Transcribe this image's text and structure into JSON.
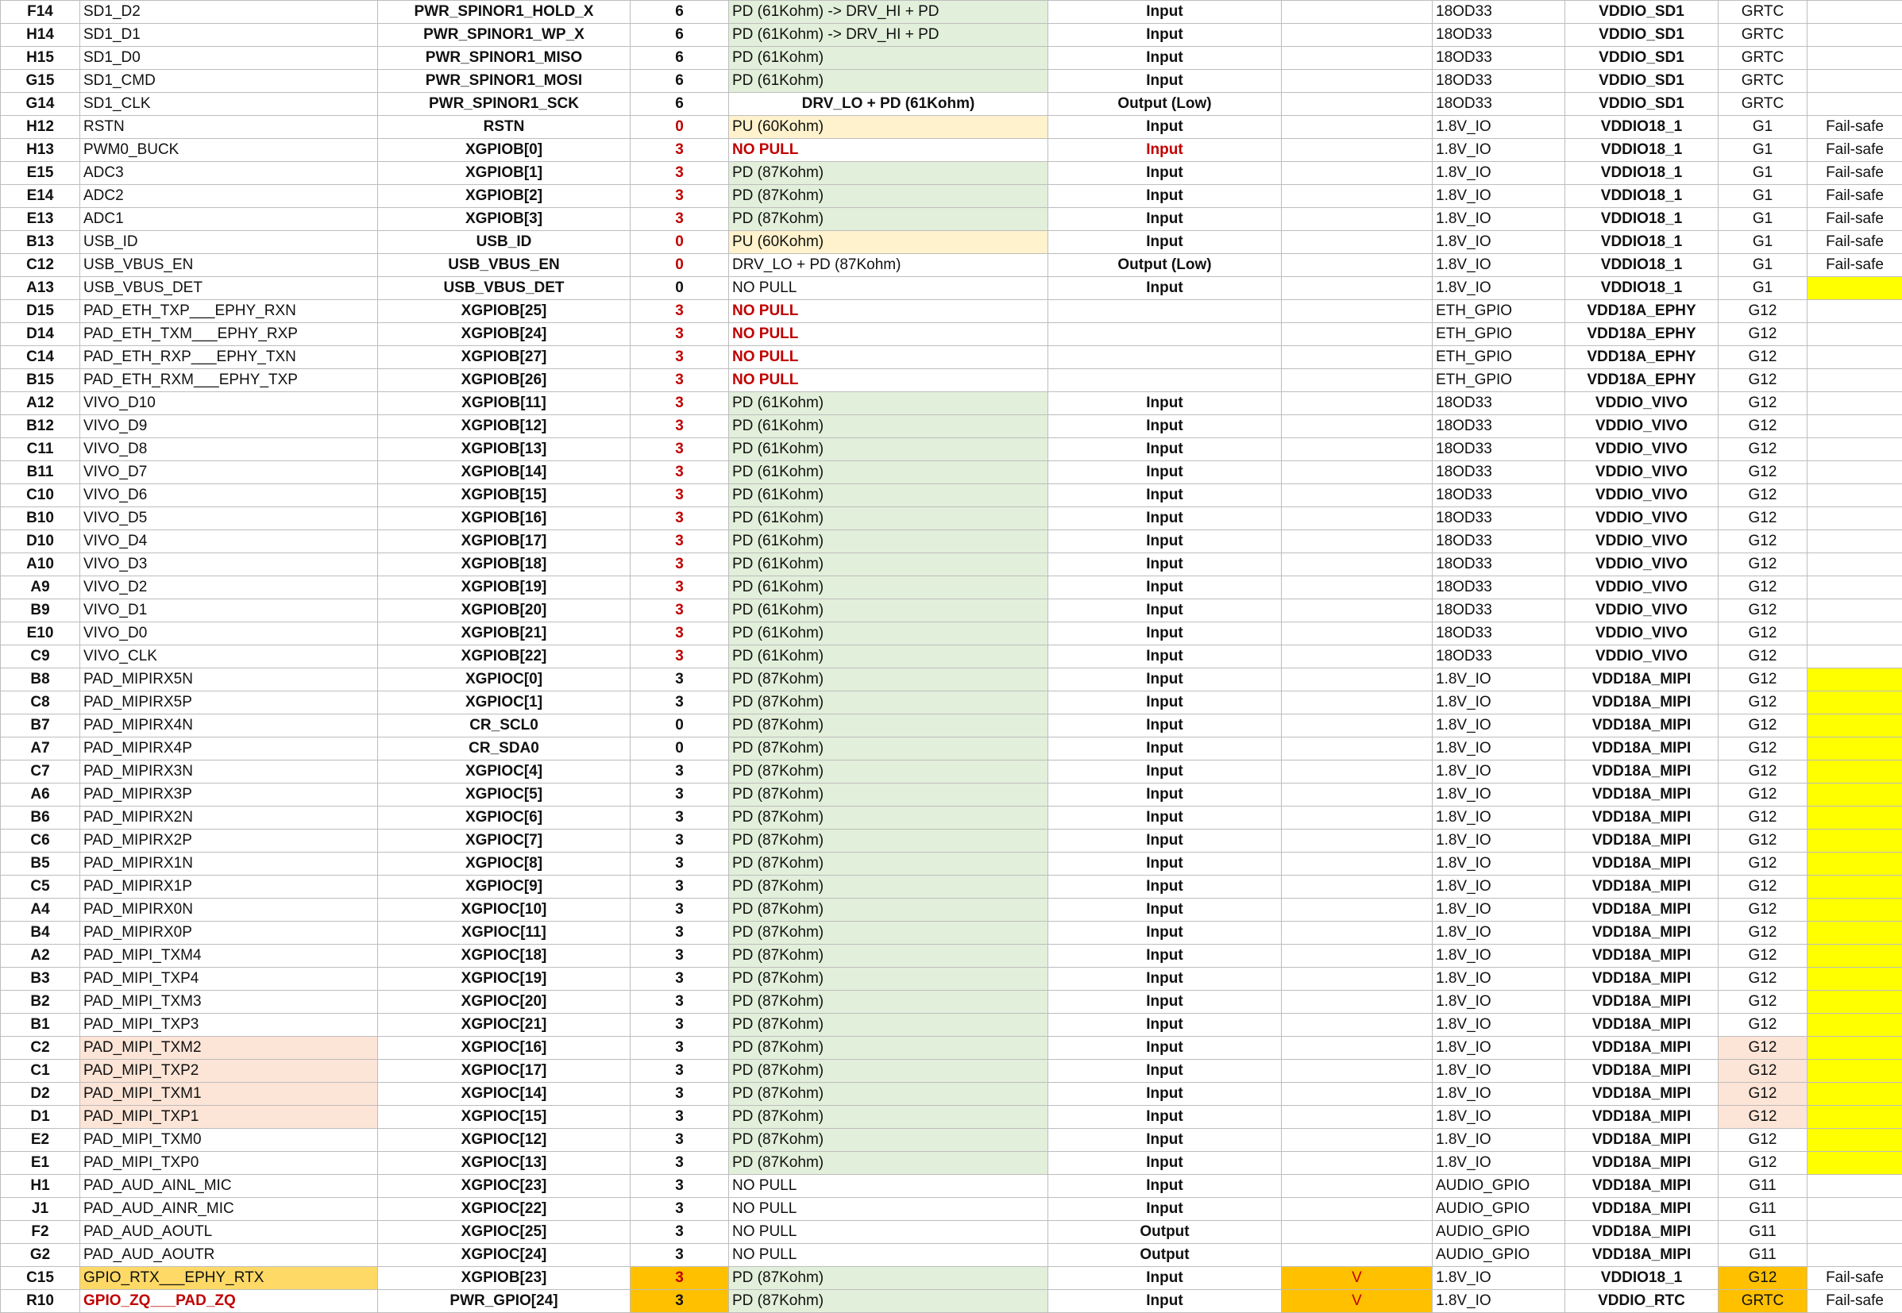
{
  "sheet": {
    "rows": [
      {
        "ball": "F14",
        "name": "SD1_D2",
        "func": "PWR_SPINOR1_HOLD_X",
        "mux": "6",
        "pull": "PD (61Kohm) -> DRV_HI + PD",
        "dir": "Input",
        "v": "",
        "iotype": "18OD33",
        "power": "VDDIO_SD1",
        "group": "GRTC",
        "note": ""
      },
      {
        "ball": "H14",
        "name": "SD1_D1",
        "func": "PWR_SPINOR1_WP_X",
        "mux": "6",
        "pull": "PD (61Kohm) -> DRV_HI + PD",
        "dir": "Input",
        "v": "",
        "iotype": "18OD33",
        "power": "VDDIO_SD1",
        "group": "GRTC",
        "note": ""
      },
      {
        "ball": "H15",
        "name": "SD1_D0",
        "func": "PWR_SPINOR1_MISO",
        "mux": "6",
        "pull": "PD (61Kohm)",
        "dir": "Input",
        "v": "",
        "iotype": "18OD33",
        "power": "VDDIO_SD1",
        "group": "GRTC",
        "note": ""
      },
      {
        "ball": "G15",
        "name": "SD1_CMD",
        "func": "PWR_SPINOR1_MOSI",
        "mux": "6",
        "pull": "PD (61Kohm)",
        "dir": "Input",
        "v": "",
        "iotype": "18OD33",
        "power": "VDDIO_SD1",
        "group": "GRTC",
        "note": ""
      },
      {
        "ball": "G14",
        "name": "SD1_CLK",
        "func": "PWR_SPINOR1_SCK",
        "mux": "6",
        "pull": "DRV_LO + PD (61Kohm)",
        "dir": "Output (Low)",
        "v": "",
        "iotype": "18OD33",
        "power": "VDDIO_SD1",
        "group": "GRTC",
        "note": ""
      },
      {
        "ball": "H12",
        "name": "RSTN",
        "func": "RSTN",
        "mux": "0",
        "pull": "PU (60Kohm)",
        "dir": "Input",
        "v": "",
        "iotype": "1.8V_IO",
        "power": "VDDIO18_1",
        "group": "G1",
        "note": "Fail-safe"
      },
      {
        "ball": "H13",
        "name": "PWM0_BUCK",
        "func": "XGPIOB[0]",
        "mux": "3",
        "pull": "NO PULL",
        "dir": "Input",
        "v": "",
        "iotype": "1.8V_IO",
        "power": "VDDIO18_1",
        "group": "G1",
        "note": "Fail-safe"
      },
      {
        "ball": "E15",
        "name": "ADC3",
        "func": "XGPIOB[1]",
        "mux": "3",
        "pull": "PD (87Kohm)",
        "dir": "Input",
        "v": "",
        "iotype": "1.8V_IO",
        "power": "VDDIO18_1",
        "group": "G1",
        "note": "Fail-safe"
      },
      {
        "ball": "E14",
        "name": "ADC2",
        "func": "XGPIOB[2]",
        "mux": "3",
        "pull": "PD (87Kohm)",
        "dir": "Input",
        "v": "",
        "iotype": "1.8V_IO",
        "power": "VDDIO18_1",
        "group": "G1",
        "note": "Fail-safe"
      },
      {
        "ball": "E13",
        "name": "ADC1",
        "func": "XGPIOB[3]",
        "mux": "3",
        "pull": "PD (87Kohm)",
        "dir": "Input",
        "v": "",
        "iotype": "1.8V_IO",
        "power": "VDDIO18_1",
        "group": "G1",
        "note": "Fail-safe"
      },
      {
        "ball": "B13",
        "name": "USB_ID",
        "func": "USB_ID",
        "mux": "0",
        "pull": "PU (60Kohm)",
        "dir": "Input",
        "v": "",
        "iotype": "1.8V_IO",
        "power": "VDDIO18_1",
        "group": "G1",
        "note": "Fail-safe"
      },
      {
        "ball": "C12",
        "name": "USB_VBUS_EN",
        "func": "USB_VBUS_EN",
        "mux": "0",
        "pull": "DRV_LO + PD (87Kohm)",
        "dir": "Output (Low)",
        "v": "",
        "iotype": "1.8V_IO",
        "power": "VDDIO18_1",
        "group": "G1",
        "note": "Fail-safe"
      },
      {
        "ball": "A13",
        "name": "USB_VBUS_DET",
        "func": "USB_VBUS_DET",
        "mux": "0",
        "pull": "NO PULL",
        "dir": "Input",
        "v": "",
        "iotype": "1.8V_IO",
        "power": "VDDIO18_1",
        "group": "G1",
        "note": ""
      },
      {
        "ball": "D15",
        "name": "PAD_ETH_TXP___EPHY_RXN",
        "func": "XGPIOB[25]",
        "mux": "3",
        "pull": "NO PULL",
        "dir": "",
        "v": "",
        "iotype": "ETH_GPIO",
        "power": "VDD18A_EPHY",
        "group": "G12",
        "note": ""
      },
      {
        "ball": "D14",
        "name": "PAD_ETH_TXM___EPHY_RXP",
        "func": "XGPIOB[24]",
        "mux": "3",
        "pull": "NO PULL",
        "dir": "",
        "v": "",
        "iotype": "ETH_GPIO",
        "power": "VDD18A_EPHY",
        "group": "G12",
        "note": ""
      },
      {
        "ball": "C14",
        "name": "PAD_ETH_RXP___EPHY_TXN",
        "func": "XGPIOB[27]",
        "mux": "3",
        "pull": "NO PULL",
        "dir": "",
        "v": "",
        "iotype": "ETH_GPIO",
        "power": "VDD18A_EPHY",
        "group": "G12",
        "note": ""
      },
      {
        "ball": "B15",
        "name": "PAD_ETH_RXM___EPHY_TXP",
        "func": "XGPIOB[26]",
        "mux": "3",
        "pull": "NO PULL",
        "dir": "",
        "v": "",
        "iotype": "ETH_GPIO",
        "power": "VDD18A_EPHY",
        "group": "G12",
        "note": ""
      },
      {
        "ball": "A12",
        "name": "VIVO_D10",
        "func": "XGPIOB[11]",
        "mux": "3",
        "pull": "PD (61Kohm)",
        "dir": "Input",
        "v": "",
        "iotype": "18OD33",
        "power": "VDDIO_VIVO",
        "group": "G12",
        "note": ""
      },
      {
        "ball": "B12",
        "name": "VIVO_D9",
        "func": "XGPIOB[12]",
        "mux": "3",
        "pull": "PD (61Kohm)",
        "dir": "Input",
        "v": "",
        "iotype": "18OD33",
        "power": "VDDIO_VIVO",
        "group": "G12",
        "note": ""
      },
      {
        "ball": "C11",
        "name": "VIVO_D8",
        "func": "XGPIOB[13]",
        "mux": "3",
        "pull": "PD (61Kohm)",
        "dir": "Input",
        "v": "",
        "iotype": "18OD33",
        "power": "VDDIO_VIVO",
        "group": "G12",
        "note": ""
      },
      {
        "ball": "B11",
        "name": "VIVO_D7",
        "func": "XGPIOB[14]",
        "mux": "3",
        "pull": "PD (61Kohm)",
        "dir": "Input",
        "v": "",
        "iotype": "18OD33",
        "power": "VDDIO_VIVO",
        "group": "G12",
        "note": ""
      },
      {
        "ball": "C10",
        "name": "VIVO_D6",
        "func": "XGPIOB[15]",
        "mux": "3",
        "pull": "PD (61Kohm)",
        "dir": "Input",
        "v": "",
        "iotype": "18OD33",
        "power": "VDDIO_VIVO",
        "group": "G12",
        "note": ""
      },
      {
        "ball": "B10",
        "name": "VIVO_D5",
        "func": "XGPIOB[16]",
        "mux": "3",
        "pull": "PD (61Kohm)",
        "dir": "Input",
        "v": "",
        "iotype": "18OD33",
        "power": "VDDIO_VIVO",
        "group": "G12",
        "note": ""
      },
      {
        "ball": "D10",
        "name": "VIVO_D4",
        "func": "XGPIOB[17]",
        "mux": "3",
        "pull": "PD (61Kohm)",
        "dir": "Input",
        "v": "",
        "iotype": "18OD33",
        "power": "VDDIO_VIVO",
        "group": "G12",
        "note": ""
      },
      {
        "ball": "A10",
        "name": "VIVO_D3",
        "func": "XGPIOB[18]",
        "mux": "3",
        "pull": "PD (61Kohm)",
        "dir": "Input",
        "v": "",
        "iotype": "18OD33",
        "power": "VDDIO_VIVO",
        "group": "G12",
        "note": ""
      },
      {
        "ball": "A9",
        "name": "VIVO_D2",
        "func": "XGPIOB[19]",
        "mux": "3",
        "pull": "PD (61Kohm)",
        "dir": "Input",
        "v": "",
        "iotype": "18OD33",
        "power": "VDDIO_VIVO",
        "group": "G12",
        "note": ""
      },
      {
        "ball": "B9",
        "name": "VIVO_D1",
        "func": "XGPIOB[20]",
        "mux": "3",
        "pull": "PD (61Kohm)",
        "dir": "Input",
        "v": "",
        "iotype": "18OD33",
        "power": "VDDIO_VIVO",
        "group": "G12",
        "note": ""
      },
      {
        "ball": "E10",
        "name": "VIVO_D0",
        "func": "XGPIOB[21]",
        "mux": "3",
        "pull": "PD (61Kohm)",
        "dir": "Input",
        "v": "",
        "iotype": "18OD33",
        "power": "VDDIO_VIVO",
        "group": "G12",
        "note": ""
      },
      {
        "ball": "C9",
        "name": "VIVO_CLK",
        "func": "XGPIOB[22]",
        "mux": "3",
        "pull": "PD (61Kohm)",
        "dir": "Input",
        "v": "",
        "iotype": "18OD33",
        "power": "VDDIO_VIVO",
        "group": "G12",
        "note": ""
      },
      {
        "ball": "B8",
        "name": "PAD_MIPIRX5N",
        "func": "XGPIOC[0]",
        "mux": "3",
        "pull": "PD (87Kohm)",
        "dir": "Input",
        "v": "",
        "iotype": "1.8V_IO",
        "power": "VDD18A_MIPI",
        "group": "G12",
        "note": ""
      },
      {
        "ball": "C8",
        "name": "PAD_MIPIRX5P",
        "func": "XGPIOC[1]",
        "mux": "3",
        "pull": "PD (87Kohm)",
        "dir": "Input",
        "v": "",
        "iotype": "1.8V_IO",
        "power": "VDD18A_MIPI",
        "group": "G12",
        "note": ""
      },
      {
        "ball": "B7",
        "name": "PAD_MIPIRX4N",
        "func": "CR_SCL0",
        "mux": "0",
        "pull": "PD (87Kohm)",
        "dir": "Input",
        "v": "",
        "iotype": "1.8V_IO",
        "power": "VDD18A_MIPI",
        "group": "G12",
        "note": ""
      },
      {
        "ball": "A7",
        "name": "PAD_MIPIRX4P",
        "func": "CR_SDA0",
        "mux": "0",
        "pull": "PD (87Kohm)",
        "dir": "Input",
        "v": "",
        "iotype": "1.8V_IO",
        "power": "VDD18A_MIPI",
        "group": "G12",
        "note": ""
      },
      {
        "ball": "C7",
        "name": "PAD_MIPIRX3N",
        "func": "XGPIOC[4]",
        "mux": "3",
        "pull": "PD (87Kohm)",
        "dir": "Input",
        "v": "",
        "iotype": "1.8V_IO",
        "power": "VDD18A_MIPI",
        "group": "G12",
        "note": ""
      },
      {
        "ball": "A6",
        "name": "PAD_MIPIRX3P",
        "func": "XGPIOC[5]",
        "mux": "3",
        "pull": "PD (87Kohm)",
        "dir": "Input",
        "v": "",
        "iotype": "1.8V_IO",
        "power": "VDD18A_MIPI",
        "group": "G12",
        "note": ""
      },
      {
        "ball": "B6",
        "name": "PAD_MIPIRX2N",
        "func": "XGPIOC[6]",
        "mux": "3",
        "pull": "PD (87Kohm)",
        "dir": "Input",
        "v": "",
        "iotype": "1.8V_IO",
        "power": "VDD18A_MIPI",
        "group": "G12",
        "note": ""
      },
      {
        "ball": "C6",
        "name": "PAD_MIPIRX2P",
        "func": "XGPIOC[7]",
        "mux": "3",
        "pull": "PD (87Kohm)",
        "dir": "Input",
        "v": "",
        "iotype": "1.8V_IO",
        "power": "VDD18A_MIPI",
        "group": "G12",
        "note": ""
      },
      {
        "ball": "B5",
        "name": "PAD_MIPIRX1N",
        "func": "XGPIOC[8]",
        "mux": "3",
        "pull": "PD (87Kohm)",
        "dir": "Input",
        "v": "",
        "iotype": "1.8V_IO",
        "power": "VDD18A_MIPI",
        "group": "G12",
        "note": ""
      },
      {
        "ball": "C5",
        "name": "PAD_MIPIRX1P",
        "func": "XGPIOC[9]",
        "mux": "3",
        "pull": "PD (87Kohm)",
        "dir": "Input",
        "v": "",
        "iotype": "1.8V_IO",
        "power": "VDD18A_MIPI",
        "group": "G12",
        "note": ""
      },
      {
        "ball": "A4",
        "name": "PAD_MIPIRX0N",
        "func": "XGPIOC[10]",
        "mux": "3",
        "pull": "PD (87Kohm)",
        "dir": "Input",
        "v": "",
        "iotype": "1.8V_IO",
        "power": "VDD18A_MIPI",
        "group": "G12",
        "note": ""
      },
      {
        "ball": "B4",
        "name": "PAD_MIPIRX0P",
        "func": "XGPIOC[11]",
        "mux": "3",
        "pull": "PD (87Kohm)",
        "dir": "Input",
        "v": "",
        "iotype": "1.8V_IO",
        "power": "VDD18A_MIPI",
        "group": "G12",
        "note": ""
      },
      {
        "ball": "A2",
        "name": "PAD_MIPI_TXM4",
        "func": "XGPIOC[18]",
        "mux": "3",
        "pull": "PD (87Kohm)",
        "dir": "Input",
        "v": "",
        "iotype": "1.8V_IO",
        "power": "VDD18A_MIPI",
        "group": "G12",
        "note": ""
      },
      {
        "ball": "B3",
        "name": "PAD_MIPI_TXP4",
        "func": "XGPIOC[19]",
        "mux": "3",
        "pull": "PD (87Kohm)",
        "dir": "Input",
        "v": "",
        "iotype": "1.8V_IO",
        "power": "VDD18A_MIPI",
        "group": "G12",
        "note": ""
      },
      {
        "ball": "B2",
        "name": "PAD_MIPI_TXM3",
        "func": "XGPIOC[20]",
        "mux": "3",
        "pull": "PD (87Kohm)",
        "dir": "Input",
        "v": "",
        "iotype": "1.8V_IO",
        "power": "VDD18A_MIPI",
        "group": "G12",
        "note": ""
      },
      {
        "ball": "B1",
        "name": "PAD_MIPI_TXP3",
        "func": "XGPIOC[21]",
        "mux": "3",
        "pull": "PD (87Kohm)",
        "dir": "Input",
        "v": "",
        "iotype": "1.8V_IO",
        "power": "VDD18A_MIPI",
        "group": "G12",
        "note": ""
      },
      {
        "ball": "C2",
        "name": "PAD_MIPI_TXM2",
        "func": "XGPIOC[16]",
        "mux": "3",
        "pull": "PD (87Kohm)",
        "dir": "Input",
        "v": "",
        "iotype": "1.8V_IO",
        "power": "VDD18A_MIPI",
        "group": "G12",
        "note": ""
      },
      {
        "ball": "C1",
        "name": "PAD_MIPI_TXP2",
        "func": "XGPIOC[17]",
        "mux": "3",
        "pull": "PD (87Kohm)",
        "dir": "Input",
        "v": "",
        "iotype": "1.8V_IO",
        "power": "VDD18A_MIPI",
        "group": "G12",
        "note": ""
      },
      {
        "ball": "D2",
        "name": "PAD_MIPI_TXM1",
        "func": "XGPIOC[14]",
        "mux": "3",
        "pull": "PD (87Kohm)",
        "dir": "Input",
        "v": "",
        "iotype": "1.8V_IO",
        "power": "VDD18A_MIPI",
        "group": "G12",
        "note": ""
      },
      {
        "ball": "D1",
        "name": "PAD_MIPI_TXP1",
        "func": "XGPIOC[15]",
        "mux": "3",
        "pull": "PD (87Kohm)",
        "dir": "Input",
        "v": "",
        "iotype": "1.8V_IO",
        "power": "VDD18A_MIPI",
        "group": "G12",
        "note": ""
      },
      {
        "ball": "E2",
        "name": "PAD_MIPI_TXM0",
        "func": "XGPIOC[12]",
        "mux": "3",
        "pull": "PD (87Kohm)",
        "dir": "Input",
        "v": "",
        "iotype": "1.8V_IO",
        "power": "VDD18A_MIPI",
        "group": "G12",
        "note": ""
      },
      {
        "ball": "E1",
        "name": "PAD_MIPI_TXP0",
        "func": "XGPIOC[13]",
        "mux": "3",
        "pull": "PD (87Kohm)",
        "dir": "Input",
        "v": "",
        "iotype": "1.8V_IO",
        "power": "VDD18A_MIPI",
        "group": "G12",
        "note": ""
      },
      {
        "ball": "H1",
        "name": "PAD_AUD_AINL_MIC",
        "func": "XGPIOC[23]",
        "mux": "3",
        "pull": "NO PULL",
        "dir": "Input",
        "v": "",
        "iotype": "AUDIO_GPIO",
        "power": "VDD18A_MIPI",
        "group": "G11",
        "note": ""
      },
      {
        "ball": "J1",
        "name": "PAD_AUD_AINR_MIC",
        "func": "XGPIOC[22]",
        "mux": "3",
        "pull": "NO PULL",
        "dir": "Input",
        "v": "",
        "iotype": "AUDIO_GPIO",
        "power": "VDD18A_MIPI",
        "group": "G11",
        "note": ""
      },
      {
        "ball": "F2",
        "name": "PAD_AUD_AOUTL",
        "func": "XGPIOC[25]",
        "mux": "3",
        "pull": "NO PULL",
        "dir": "Output",
        "v": "",
        "iotype": "AUDIO_GPIO",
        "power": "VDD18A_MIPI",
        "group": "G11",
        "note": ""
      },
      {
        "ball": "G2",
        "name": "PAD_AUD_AOUTR",
        "func": "XGPIOC[24]",
        "mux": "3",
        "pull": "NO PULL",
        "dir": "Output",
        "v": "",
        "iotype": "AUDIO_GPIO",
        "power": "VDD18A_MIPI",
        "group": "G11",
        "note": ""
      },
      {
        "ball": "C15",
        "name": "GPIO_RTX___EPHY_RTX",
        "func": "XGPIOB[23]",
        "mux": "3",
        "pull": "PD (87Kohm)",
        "dir": "Input",
        "v": "V",
        "iotype": "1.8V_IO",
        "power": "VDDIO18_1",
        "group": "G12",
        "note": "Fail-safe"
      },
      {
        "ball": "R10",
        "name": "GPIO_ZQ___PAD_ZQ",
        "func": "PWR_GPIO[24]",
        "mux": "3",
        "pull": "PD (87Kohm)",
        "dir": "Input",
        "v": "V",
        "iotype": "1.8V_IO",
        "power": "VDDIO_RTC",
        "group": "GRTC",
        "note": "Fail-safe"
      }
    ],
    "colors": {
      "green": "#e2efda",
      "cream": "#fff2cc",
      "yellow": "#ffff00",
      "peach": "#fce4d6",
      "orange": "#ffc000",
      "red_text": "#c00000"
    }
  }
}
